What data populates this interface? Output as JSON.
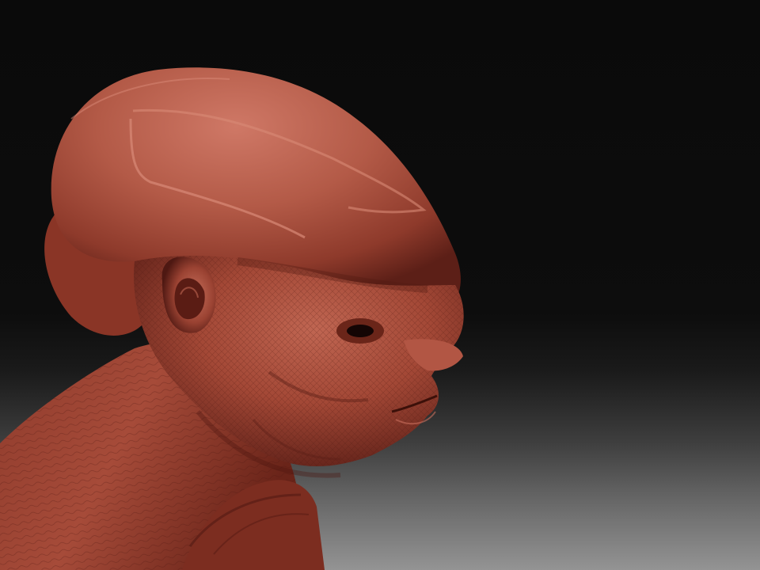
{
  "scene": {
    "subject": "alien-head-sculpt",
    "colors": {
      "background_top": "#0a0a0a",
      "background_bottom": "#8a8a8a",
      "skin_highlight": "#c86c5a",
      "skin_mid": "#a14634",
      "skin_shadow": "#5a1e16",
      "cavity": "#140504"
    }
  }
}
